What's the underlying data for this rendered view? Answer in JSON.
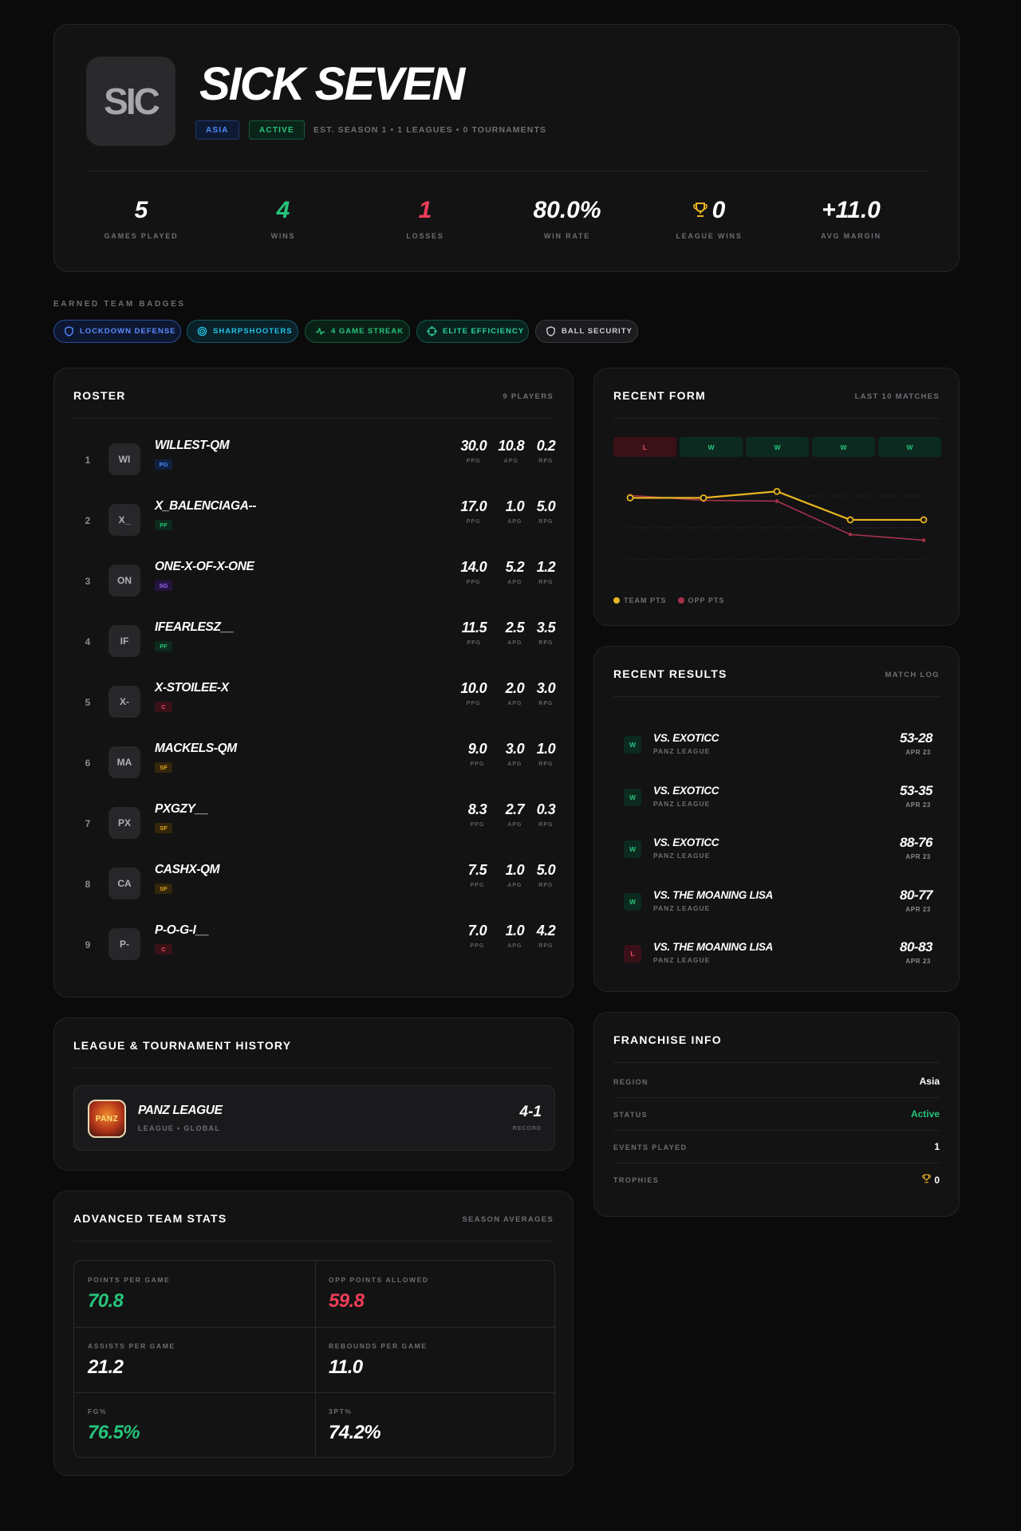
{
  "team": {
    "logo_text": "SIC",
    "name": "SICK SEVEN",
    "region_tag": "ASIA",
    "status_tag": "ACTIVE",
    "est_line": "EST. SEASON 1 • 1 LEAGUES • 0 TOURNAMENTS"
  },
  "stats": [
    {
      "value": "5",
      "label": "GAMES PLAYED",
      "color": "#ffffff"
    },
    {
      "value": "4",
      "label": "WINS",
      "color": "#26c47a"
    },
    {
      "value": "1",
      "label": "LOSSES",
      "color": "#ef3d5a"
    },
    {
      "value": "80.0%",
      "label": "WIN RATE",
      "color": "#ffffff"
    },
    {
      "value": "0",
      "label": "LEAGUE WINS",
      "color": "#ffffff",
      "icon": "trophy-icon"
    },
    {
      "value": "+11.0",
      "label": "AVG MARGIN",
      "color": "#ffffff"
    }
  ],
  "badges": {
    "title": "EARNED TEAM BADGES",
    "items": [
      {
        "label": "LOCKDOWN DEFENSE",
        "icon": "shield-icon",
        "color": "#5a8cff"
      },
      {
        "label": "SHARPSHOOTERS",
        "icon": "target-icon",
        "color": "#22c3e6"
      },
      {
        "label": "4 GAME STREAK",
        "icon": "pulse-icon",
        "color": "#26c47a"
      },
      {
        "label": "ELITE EFFICIENCY",
        "icon": "crosshair-icon",
        "color": "#2bd4a4"
      },
      {
        "label": "BALL SECURITY",
        "icon": "shield-icon",
        "color": "#d0d0d4"
      }
    ]
  },
  "roster": {
    "title": "ROSTER",
    "count": "9 PLAYERS",
    "stat_labels": {
      "ppg": "PPG",
      "apg": "APG",
      "rpg": "RPG"
    },
    "players": [
      {
        "rank": "1",
        "initials": "WI",
        "name": "WILLEST-QM",
        "pos": "PG",
        "ppg": "30.0",
        "apg": "10.8",
        "rpg": "0.2"
      },
      {
        "rank": "2",
        "initials": "X_",
        "name": "X_BALENCIAGA--",
        "pos": "PF",
        "ppg": "17.0",
        "apg": "1.0",
        "rpg": "5.0"
      },
      {
        "rank": "3",
        "initials": "ON",
        "name": "ONE-X-OF-X-ONE",
        "pos": "SG",
        "ppg": "14.0",
        "apg": "5.2",
        "rpg": "1.2"
      },
      {
        "rank": "4",
        "initials": "IF",
        "name": "IFEARLESZ__",
        "pos": "PF",
        "ppg": "11.5",
        "apg": "2.5",
        "rpg": "3.5"
      },
      {
        "rank": "5",
        "initials": "X-",
        "name": "X-STOILEE-X",
        "pos": "C",
        "ppg": "10.0",
        "apg": "2.0",
        "rpg": "3.0"
      },
      {
        "rank": "6",
        "initials": "MA",
        "name": "MACKELS-QM",
        "pos": "SF",
        "ppg": "9.0",
        "apg": "3.0",
        "rpg": "1.0"
      },
      {
        "rank": "7",
        "initials": "PX",
        "name": "PXGZY__",
        "pos": "SF",
        "ppg": "8.3",
        "apg": "2.7",
        "rpg": "0.3"
      },
      {
        "rank": "8",
        "initials": "CA",
        "name": "CASHX-QM",
        "pos": "SF",
        "ppg": "7.5",
        "apg": "1.0",
        "rpg": "5.0"
      },
      {
        "rank": "9",
        "initials": "P-",
        "name": "P-O-G-I__",
        "pos": "C",
        "ppg": "7.0",
        "apg": "1.0",
        "rpg": "4.2"
      }
    ]
  },
  "form": {
    "title": "RECENT FORM",
    "sub": "LAST 10 MATCHES",
    "results": [
      "L",
      "W",
      "W",
      "W",
      "W"
    ],
    "legend_team": "TEAM PTS",
    "legend_opp": "OPP PTS",
    "team_color": "#e9b521",
    "opp_color": "#a3314a"
  },
  "chart_data": {
    "type": "line",
    "x": [
      1,
      2,
      3,
      4,
      5
    ],
    "series": [
      {
        "name": "TEAM PTS",
        "values": [
          80,
          80,
          88,
          53,
          53
        ]
      },
      {
        "name": "OPP PTS",
        "values": [
          83,
          77,
          76,
          35,
          28
        ]
      }
    ],
    "ylim": [
      0,
      100
    ],
    "grid": true,
    "legend": "bottom-left"
  },
  "results": {
    "title": "RECENT RESULTS",
    "sub": "MATCH LOG",
    "items": [
      {
        "res": "W",
        "opp": "VS. EXOTICC",
        "league": "PANZ LEAGUE",
        "score": "53-28",
        "date": "APR 23"
      },
      {
        "res": "W",
        "opp": "VS. EXOTICC",
        "league": "PANZ LEAGUE",
        "score": "53-35",
        "date": "APR 23"
      },
      {
        "res": "W",
        "opp": "VS. EXOTICC",
        "league": "PANZ LEAGUE",
        "score": "88-76",
        "date": "APR 23"
      },
      {
        "res": "W",
        "opp": "VS. THE MOANING LISA",
        "league": "PANZ LEAGUE",
        "score": "80-77",
        "date": "APR 23"
      },
      {
        "res": "L",
        "opp": "VS. THE MOANING LISA",
        "league": "PANZ LEAGUE",
        "score": "80-83",
        "date": "APR 23"
      }
    ]
  },
  "history": {
    "title": "LEAGUE & TOURNAMENT HISTORY",
    "league_name": "PANZ LEAGUE",
    "league_meta": "LEAGUE • GLOBAL",
    "logo_text": "PANZ",
    "record": "4-1",
    "record_label": "RECORD"
  },
  "franchise": {
    "title": "FRANCHISE INFO",
    "rows": [
      {
        "label": "REGION",
        "value": "Asia",
        "color": "#ffffff"
      },
      {
        "label": "STATUS",
        "value": "Active",
        "color": "#26c47a"
      },
      {
        "label": "EVENTS PLAYED",
        "value": "1",
        "color": "#ffffff"
      },
      {
        "label": "TROPHIES",
        "value": "0",
        "color": "#ffffff",
        "icon": "trophy-icon"
      }
    ]
  },
  "advanced": {
    "title": "ADVANCED TEAM STATS",
    "sub": "SEASON AVERAGES",
    "cells": [
      {
        "label": "POINTS PER GAME",
        "value": "70.8",
        "color": "#26c47a"
      },
      {
        "label": "OPP POINTS ALLOWED",
        "value": "59.8",
        "color": "#ef3d5a"
      },
      {
        "label": "ASSISTS PER GAME",
        "value": "21.2",
        "color": "#ffffff"
      },
      {
        "label": "REBOUNDS PER GAME",
        "value": "11.0",
        "color": "#ffffff"
      },
      {
        "label": "FG%",
        "value": "76.5%",
        "color": "#26c47a"
      },
      {
        "label": "3PT%",
        "value": "74.2%",
        "color": "#ffffff"
      }
    ]
  }
}
